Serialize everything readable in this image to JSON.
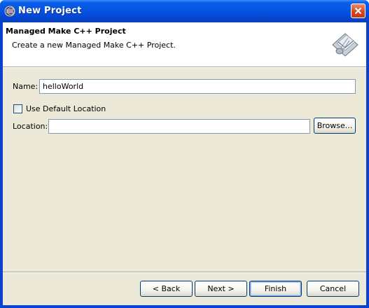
{
  "window": {
    "title": "New Project"
  },
  "header": {
    "title": "Managed Make C++ Project",
    "description": "Create a new Managed Make C++ Project."
  },
  "form": {
    "name_label": "Name:",
    "name_value": "helloWorld",
    "use_default_location_label": "Use Default Location",
    "use_default_location_checked": false,
    "location_label": "Location:",
    "location_value": "",
    "browse_label": "Browse..."
  },
  "buttons": {
    "back": "< Back",
    "next": "Next >",
    "finish": "Finish",
    "cancel": "Cancel"
  }
}
